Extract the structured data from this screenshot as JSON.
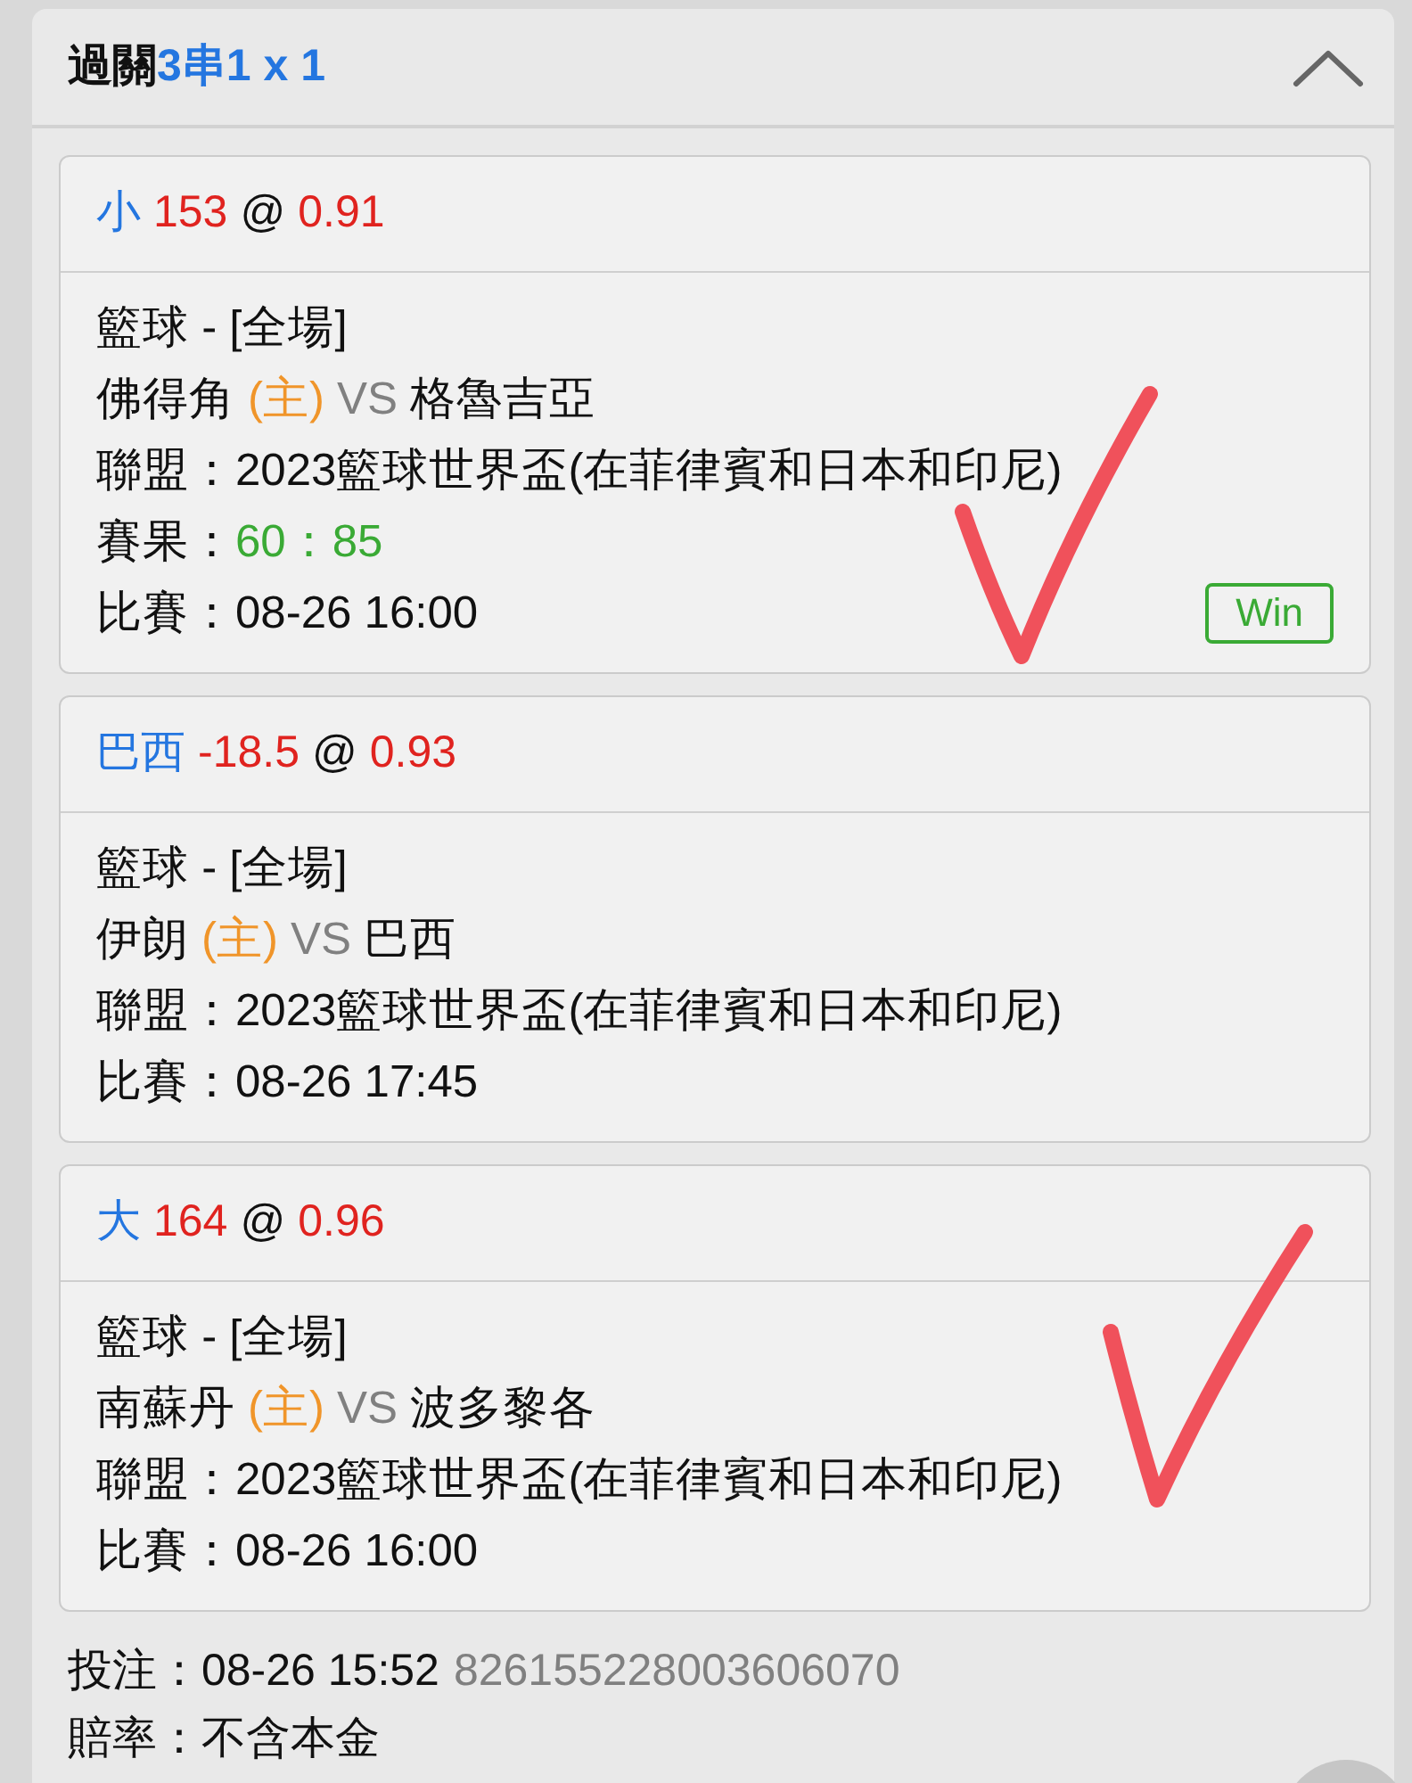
{
  "panel": {
    "title": "過關",
    "parlay": "3串1 x 1",
    "expanded": true,
    "bets": [
      {
        "selection": "小",
        "line": "153",
        "at": "@",
        "odds": "0.91",
        "sport": "籃球 - [全場]",
        "home": "佛得角",
        "home_tag": "(主)",
        "vs": "VS",
        "away": "格魯吉亞",
        "league": {
          "label": "聯盟：",
          "value": "2023籃球世界盃(在菲律賓和日本和印尼)"
        },
        "result": {
          "label": "賽果：",
          "value": "60：85"
        },
        "match_time": {
          "label": "比賽：",
          "value": "08-26 16:00"
        },
        "status_badge": "Win",
        "hand_check": true
      },
      {
        "selection": "巴西",
        "line": "-18.5",
        "at": "@",
        "odds": "0.93",
        "sport": "籃球 - [全場]",
        "home": "伊朗",
        "home_tag": "(主)",
        "vs": "VS",
        "away": "巴西",
        "league": {
          "label": "聯盟：",
          "value": "2023籃球世界盃(在菲律賓和日本和印尼)"
        },
        "match_time": {
          "label": "比賽：",
          "value": "08-26 17:45"
        },
        "hand_check": false
      },
      {
        "selection": "大",
        "line": "164",
        "at": "@",
        "odds": "0.96",
        "sport": "籃球 - [全場]",
        "home": "南蘇丹",
        "home_tag": "(主)",
        "vs": "VS",
        "away": "波多黎各",
        "league": {
          "label": "聯盟：",
          "value": "2023籃球世界盃(在菲律賓和日本和印尼)"
        },
        "match_time": {
          "label": "比賽：",
          "value": "08-26 16:00"
        },
        "hand_check": true
      }
    ],
    "bet_time": {
      "label": "投注：",
      "value": "08-26 15:52"
    },
    "ticket_no": "826155228003606070",
    "odds_note": {
      "label": "賠率：",
      "value": "不含本金"
    }
  }
}
